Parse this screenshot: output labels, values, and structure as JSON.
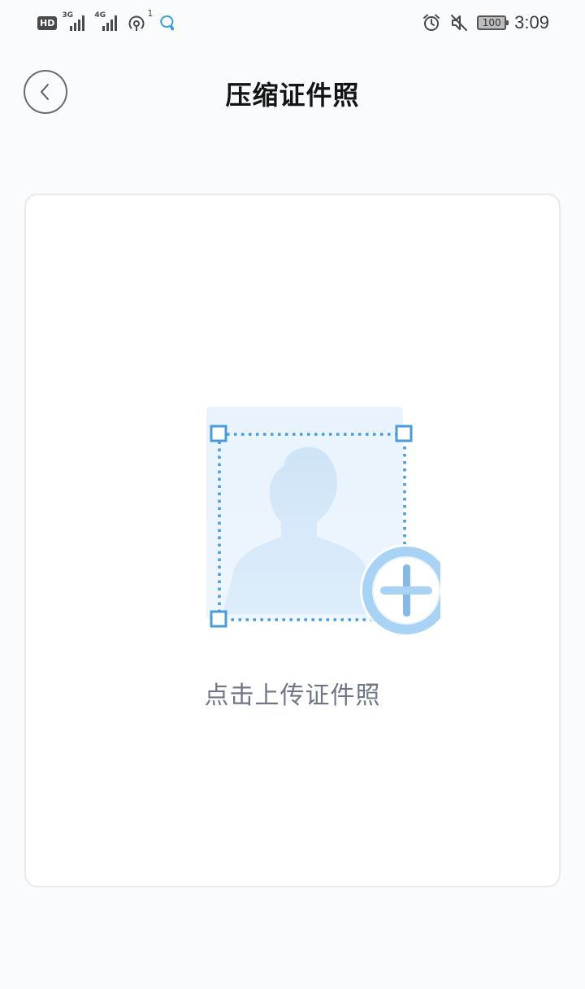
{
  "status_bar": {
    "hd": "HD",
    "net1": "3G",
    "net2": "4G",
    "hotspot_count": "1",
    "battery": "100",
    "time": "3:09"
  },
  "header": {
    "title": "压缩证件照"
  },
  "upload": {
    "label": "点击上传证件照"
  }
}
